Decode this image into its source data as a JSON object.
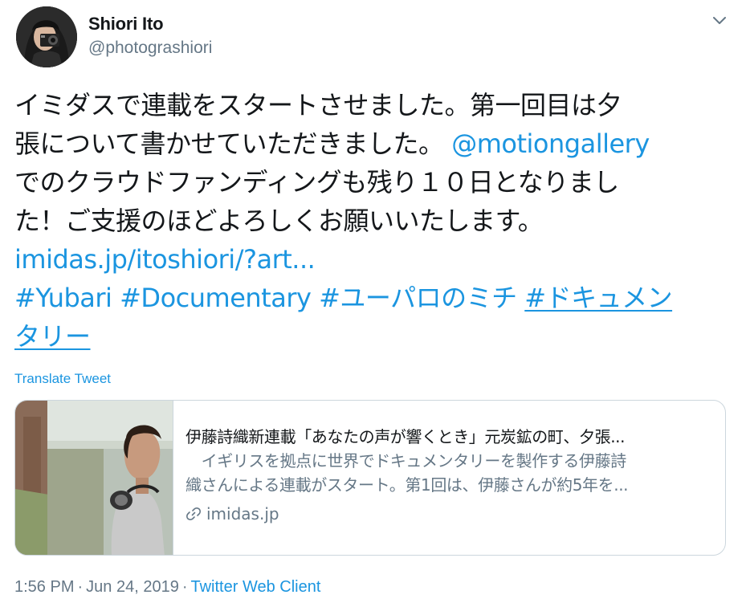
{
  "user": {
    "display_name": "Shiori Ito",
    "handle": "@photograshiori",
    "avatar_icon": "avatar-photo"
  },
  "menu_icon": "chevron-down-icon",
  "tweet": {
    "line1": "イミダスで連載をスタートさせました。第一回目は夕",
    "line2_text": "張について書かせていただきました。",
    "line2_mention": "@motiongallery",
    "line3": "でのクラウドファンディングも残り１０日となりまし",
    "line4": "た！ご支援のほどよろしくお願いいたします。",
    "link_url": "imidas.jp/itoshiori/?art...",
    "hashtag1": "#Yubari",
    "hashtag2": "#Documentary",
    "hashtag3": "#ユーパロのミチ",
    "hashtag4_part1": "#ドキュメン",
    "hashtag4_part2": "タリー"
  },
  "translate_label": "Translate Tweet",
  "card": {
    "title": "伊藤詩織新連載「あなたの声が響くとき」元炭鉱の町、夕張...",
    "desc_line1": "　イギリスを拠点に世界でドキュメンタリーを製作する伊藤詩",
    "desc_line2": "織さんによる連載がスタート。第1回は、伊藤さんが約5年を...",
    "domain": "imidas.jp",
    "link_icon": "link-icon"
  },
  "meta": {
    "time": "1:56 PM",
    "separator": "·",
    "date": "Jun 24, 2019",
    "client": "Twitter Web Client"
  },
  "colors": {
    "link": "#1b95e0",
    "secondary": "#657786",
    "text": "#14171a",
    "border": "#ccd6dd"
  }
}
